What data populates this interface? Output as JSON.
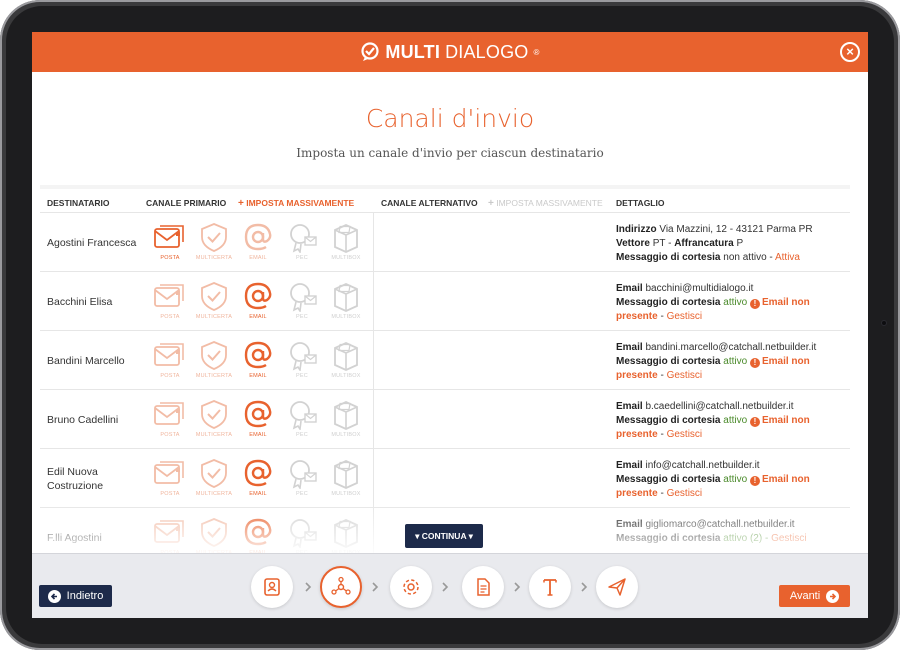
{
  "header": {
    "brand_bold": "MULTI",
    "brand_light": "DIALOGO",
    "brand_mark": "®"
  },
  "page": {
    "title": "Canali d'invio",
    "subtitle": "Imposta un canale d'invio per ciascun destinatario"
  },
  "table": {
    "col_recipient": "DESTINATARIO",
    "col_primary": "CANALE PRIMARIO",
    "bulk_primary": "IMPOSTA MASSIVAMENTE",
    "col_alternative": "CANALE ALTERNATIVO",
    "bulk_alternative": "IMPOSTA MASSIVAMENTE",
    "col_detail": "DETTAGLIO",
    "channel_labels": [
      "POSTA",
      "MULTICERTA",
      "EMAIL",
      "PEC",
      "MULTIBOX"
    ],
    "rows": [
      {
        "name": "Agostini Francesca",
        "detail": {
          "l1_key": "Indirizzo",
          "l1_val": "Via Mazzini, 12 - 43121 Parma PR",
          "l2_key": "Vettore",
          "l2_val": "PT -",
          "l2_key2": "Affrancatura",
          "l2_val2": "P",
          "l3_key": "Messaggio di cortesia",
          "l3_val": "non attivo -",
          "l3_link": "Attiva"
        }
      },
      {
        "name": "Bacchini Elisa",
        "detail": {
          "email_key": "Email",
          "email": "bacchini@multidialogo.it",
          "msg_key": "Messaggio di cortesia",
          "status": "attivo",
          "warn_a": "Email non",
          "warn_b": "presente",
          "link": "Gestisci"
        }
      },
      {
        "name": "Bandini Marcello",
        "detail": {
          "email_key": "Email",
          "email": "bandini.marcello@catchall.netbuilder.it",
          "msg_key": "Messaggio di cortesia",
          "status": "attivo",
          "warn_a": "Email non",
          "warn_b": "presente",
          "link": "Gestisci"
        }
      },
      {
        "name": "Bruno Cadellini",
        "detail": {
          "email_key": "Email",
          "email": "b.caedellini@catchall.netbuilder.it",
          "msg_key": "Messaggio di cortesia",
          "status": "attivo",
          "warn_a": "Email non",
          "warn_b": "presente",
          "link": "Gestisci"
        }
      },
      {
        "name": "Edil Nuova Costruzione",
        "detail": {
          "email_key": "Email",
          "email": "info@catchall.netbuilder.it",
          "msg_key": "Messaggio di cortesia",
          "status": "attivo",
          "warn_a": "Email non",
          "warn_b": "presente",
          "link": "Gestisci"
        }
      },
      {
        "name": "F.lli Agostini",
        "detail": {
          "email_key": "Email",
          "email": "gigliomarco@catchall.netbuilder.it",
          "msg_key": "Messaggio di cortesia",
          "status": "attivo (2) -",
          "link": "Gestisci"
        }
      }
    ]
  },
  "continua": "CONTINUA",
  "nav": {
    "back": "Indietro",
    "next": "Avanti"
  },
  "colors": {
    "accent": "#e8622e",
    "navy": "#1d2a4a",
    "green": "#4a8a2a"
  }
}
